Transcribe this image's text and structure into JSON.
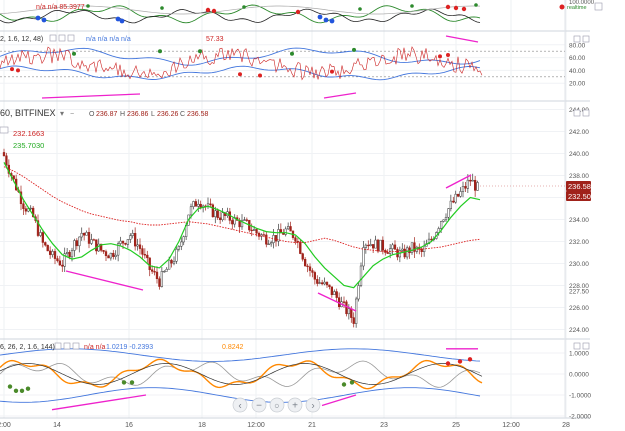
{
  "header": {
    "main_symbol": "60, BITFINEX",
    "ohlc": {
      "o_label": "O",
      "o_value": "236.87",
      "h_label": "H",
      "h_value": "236.86",
      "l_label": "L",
      "l_value": "236.26",
      "c_label": "C",
      "c_value": "236.58"
    },
    "main_legend_red": "232.1663",
    "main_legend_green": "235.7030",
    "pane1_legend": "n/a  n/a  85.3977",
    "pane2_legend_params": "2, 1.6, 12, 48)",
    "pane2_legend_na": "n/a  n/a  n/a  n/a",
    "pane2_legend_value": "57.33",
    "pane3_legend_params": "6, 26, 2, 1.6, 144)",
    "pane3_legend_na": "n/a  n/a",
    "pane3_legend_values": "1.0219  -0.2393",
    "pane3_legend_tail": "0.8242",
    "realtime_label": "realtime"
  },
  "price_badges": {
    "current": "236.58",
    "secondary": "232.50"
  },
  "x_axis": {
    "labels": [
      "2:00",
      "14",
      "16",
      "18",
      "12:00",
      "21",
      "23",
      "25",
      "12:00",
      "28"
    ]
  },
  "y_axes": {
    "pane1": [
      "100.0000"
    ],
    "pane2": [
      "80.00",
      "60.00",
      "40.00",
      "20.00"
    ],
    "main": [
      "244.00",
      "242.00",
      "240.00",
      "238.00",
      "236.00",
      "234.00",
      "232.00",
      "230.00",
      "228.00",
      "227.50",
      "226.00",
      "224.00"
    ],
    "pane3": [
      "1.0000",
      "0.0000",
      "-1.0000",
      "-2.0000"
    ]
  },
  "navigation": {
    "prev": "‹",
    "zoom_out": "−",
    "reset": "○",
    "zoom_in": "+",
    "next": "›"
  },
  "colors": {
    "price_up": "#3a3a3a",
    "price_down": "#a0221a",
    "ma_fast": "#22cc22",
    "ma_slow": "#dd2222",
    "divergence": "#ee22cc",
    "band": "#4477dd",
    "osc_orange": "#ff8800"
  },
  "chart_data": {
    "type": "line",
    "title": "",
    "ylim": [
      223.5,
      244.5
    ],
    "candles_close_approx": [
      239.8,
      237.5,
      235.4,
      234.2,
      231.8,
      230.6,
      230.0,
      231.5,
      232.8,
      232.0,
      231.2,
      230.8,
      231.8,
      232.6,
      231.4,
      229.5,
      228.4,
      229.8,
      231.2,
      234.6,
      235.8,
      235.0,
      234.4,
      234.2,
      233.8,
      233.5,
      232.8,
      232.3,
      232.4,
      233.0,
      232.5,
      230.2,
      228.6,
      228.0,
      227.2,
      226.0,
      224.9,
      232.0,
      231.8,
      231.5,
      231.2,
      230.8,
      231.4,
      231.0,
      232.2,
      234.0,
      235.3,
      236.4,
      237.6,
      236.58
    ],
    "series": [
      {
        "name": "232.1663",
        "values": [
          238.8,
          238.4,
          237.9,
          237.3,
          236.7,
          236.1,
          235.6,
          235.2,
          234.8,
          234.5,
          234.3,
          234.1,
          233.9,
          233.8,
          233.6,
          233.5,
          233.5,
          233.6,
          233.7,
          233.8,
          233.7,
          233.6,
          233.4,
          233.2,
          233.0,
          232.8,
          232.6,
          232.4,
          232.2,
          232.0,
          231.9,
          231.9,
          232.1,
          232.3,
          232.1,
          231.8,
          231.5,
          231.3,
          231.2,
          231.1,
          231.1,
          231.1,
          231.2,
          231.3,
          231.4,
          231.5,
          231.7,
          231.9,
          232.1,
          232.2
        ]
      },
      {
        "name": "235.7030",
        "values": [
          239.2,
          237.5,
          235.8,
          234.4,
          233.0,
          231.8,
          230.8,
          230.4,
          230.6,
          231.2,
          231.7,
          231.8,
          231.6,
          231.2,
          230.6,
          229.8,
          229.6,
          230.4,
          232.0,
          234.0,
          235.0,
          235.2,
          234.9,
          234.5,
          234.0,
          233.6,
          233.2,
          232.9,
          232.8,
          232.8,
          232.6,
          231.8,
          230.6,
          229.6,
          228.8,
          228.0,
          227.8,
          228.8,
          229.8,
          230.4,
          230.8,
          231.0,
          231.2,
          231.5,
          232.0,
          233.0,
          234.2,
          235.2,
          236.0,
          235.8
        ]
      }
    ]
  }
}
